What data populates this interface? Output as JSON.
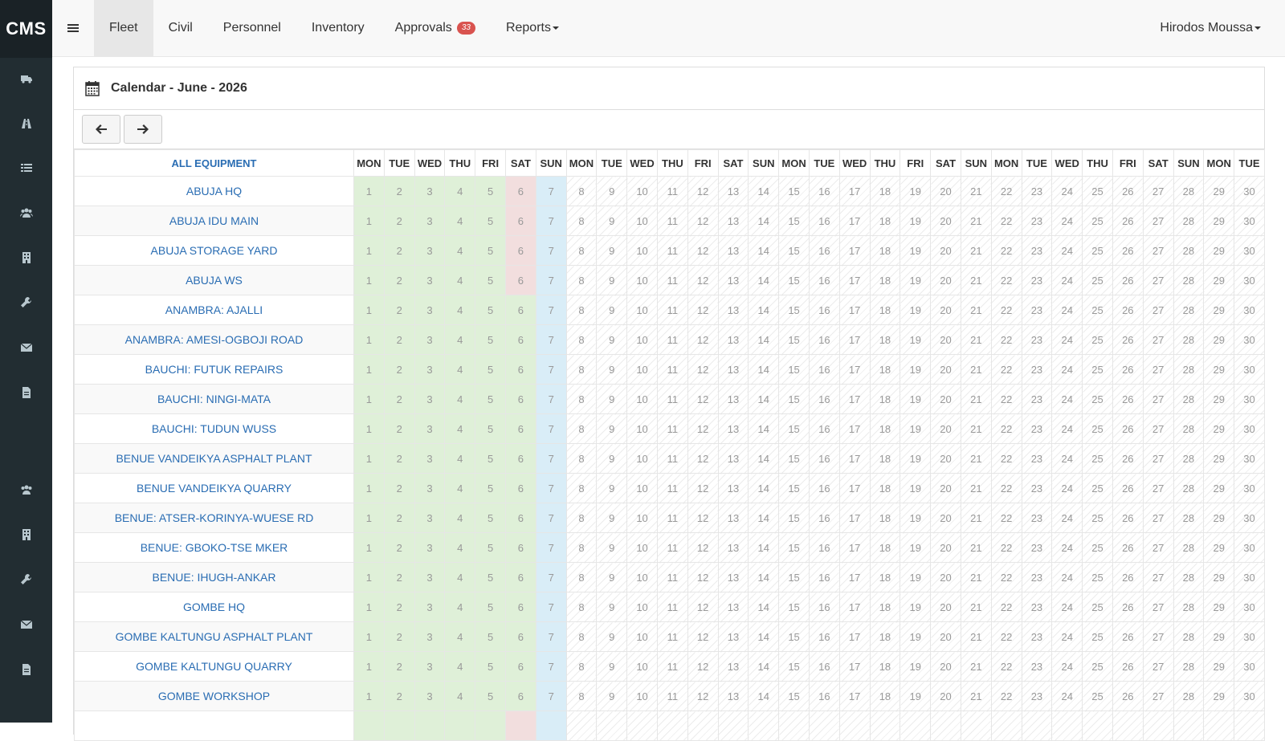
{
  "app": {
    "brand": "CMS"
  },
  "topnav": {
    "items": [
      {
        "label": "Fleet",
        "active": true
      },
      {
        "label": "Civil",
        "active": false
      },
      {
        "label": "Personnel",
        "active": false
      },
      {
        "label": "Inventory",
        "active": false
      },
      {
        "label": "Approvals",
        "active": false,
        "badge": "33"
      },
      {
        "label": "Reports",
        "active": false,
        "dropdown": true
      }
    ],
    "user": "Hirodos Moussa"
  },
  "sidebar": {
    "icons": [
      "truck-icon",
      "road-icon",
      "list-icon",
      "users-icon",
      "building-icon",
      "wrench-icon",
      "envelope-icon",
      "file-icon",
      "users-icon",
      "building-icon",
      "wrench-icon",
      "envelope-icon",
      "file-icon"
    ]
  },
  "calendar": {
    "title": "Calendar - June - 2026",
    "equipment_header": "ALL EQUIPMENT",
    "day_headers": [
      "MON",
      "TUE",
      "WED",
      "THU",
      "FRI",
      "SAT",
      "SUN",
      "MON",
      "TUE",
      "WED",
      "THU",
      "FRI",
      "SAT",
      "SUN",
      "MON",
      "TUE",
      "WED",
      "THU",
      "FRI",
      "SAT",
      "SUN",
      "MON",
      "TUE",
      "WED",
      "THU",
      "FRI",
      "SAT",
      "SUN",
      "MON",
      "TUE"
    ],
    "rows": [
      {
        "name": "ABUJA HQ",
        "red_sat": true
      },
      {
        "name": "ABUJA IDU MAIN",
        "red_sat": true
      },
      {
        "name": "ABUJA STORAGE YARD",
        "red_sat": true
      },
      {
        "name": "ABUJA WS",
        "red_sat": true
      },
      {
        "name": "ANAMBRA: AJALLI",
        "red_sat": false
      },
      {
        "name": "ANAMBRA: AMESI-OGBOJI ROAD",
        "red_sat": false
      },
      {
        "name": "BAUCHI: FUTUK REPAIRS",
        "red_sat": false
      },
      {
        "name": "BAUCHI: NINGI-MATA",
        "red_sat": false
      },
      {
        "name": "BAUCHI: TUDUN WUSS",
        "red_sat": false
      },
      {
        "name": "BENUE VANDEIKYA ASPHALT PLANT",
        "red_sat": false
      },
      {
        "name": "BENUE VANDEIKYA QUARRY",
        "red_sat": false
      },
      {
        "name": "BENUE: ATSER-KORINYA-WUESE RD",
        "red_sat": false
      },
      {
        "name": "BENUE: GBOKO-TSE MKER",
        "red_sat": false
      },
      {
        "name": "BENUE: IHUGH-ANKAR",
        "red_sat": false
      },
      {
        "name": "GOMBE HQ",
        "red_sat": false
      },
      {
        "name": "GOMBE KALTUNGU ASPHALT PLANT",
        "red_sat": false
      },
      {
        "name": "GOMBE KALTUNGU QUARRY",
        "red_sat": false
      },
      {
        "name": "GOMBE WORKSHOP",
        "red_sat": false
      },
      {
        "name": "",
        "red_sat": true
      }
    ]
  },
  "colors": {
    "sidebar": "#222d32",
    "link": "#2a6db3",
    "past": "#dff0d8",
    "sat_red": "#f2dede",
    "today": "#d9edf7",
    "badge": "#d9534f"
  }
}
